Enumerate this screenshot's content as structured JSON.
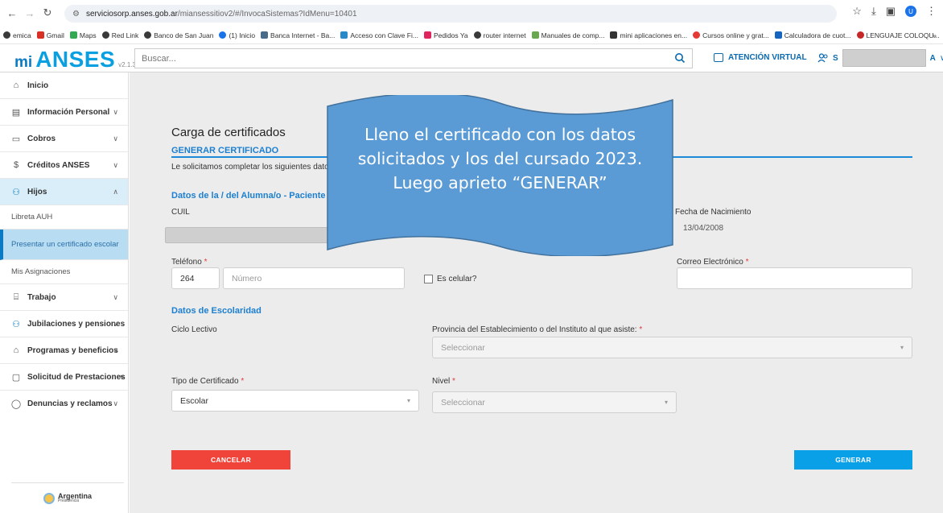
{
  "browser": {
    "url_host": "serviciosorp.anses.gob.ar",
    "url_path": "/miansessitiov2/#/InvocaSistemas?IdMenu=10401",
    "bookmarks": [
      "emica",
      "Gmail",
      "Maps",
      "Red Link",
      "Banco de San Juan",
      "(1) Inicio",
      "Banca Internet - Ba...",
      "Acceso con Clave Fi...",
      "Pedidos Ya",
      "router internet",
      "Manuales de comp...",
      "mini aplicaciones en...",
      "Cursos online y grat...",
      "Calculadora de cuot...",
      "LENGUAJE COLOQU..."
    ],
    "profile_initial": "U"
  },
  "header": {
    "logo_mi": "mi",
    "logo_anses": "ANSES",
    "version": "v2.1.3",
    "search_placeholder": "Buscar...",
    "virtual_label": "ATENCIÓN VIRTUAL",
    "user_initial": "S",
    "user_suffix": "A"
  },
  "sidebar": {
    "items": [
      {
        "label": "Inicio"
      },
      {
        "label": "Información Personal"
      },
      {
        "label": "Cobros"
      },
      {
        "label": "Créditos ANSES"
      },
      {
        "label": "Hijos"
      },
      {
        "label": "Trabajo"
      },
      {
        "label": "Jubilaciones y pensiones"
      },
      {
        "label": "Programas y beneficios"
      },
      {
        "label": "Solicitud de Prestaciones"
      },
      {
        "label": "Denuncias y reclamos"
      }
    ],
    "subitems": [
      {
        "label": "Libreta AUH"
      },
      {
        "label": "Presentar un certificado escolar"
      },
      {
        "label": "Mis Asignaciones"
      }
    ],
    "footer_brand": "Argentina",
    "footer_sub": "Presidencia"
  },
  "form": {
    "title": "Carga de certificados",
    "section_generate": "GENERAR CERTIFICADO",
    "intro": "Le solicitamos completar los siguientes dato",
    "section_student": "Datos de la / del Alumna/o - Paciente",
    "cuil_label": "CUIL",
    "birth_label": "Fecha de Nacimiento",
    "birth_value": "13/04/2008",
    "phone_label": "Teléfono",
    "phone_area": "264",
    "phone_placeholder": "Número",
    "is_mobile_label": "Es celular?",
    "email_label": "Correo Electrónico",
    "required_mark": "*",
    "section_school": "Datos de Escolaridad",
    "cycle_label": "Ciclo Lectivo",
    "province_label": "Provincia del Establecimiento o del Instituto al que asiste:",
    "province_placeholder": "Seleccionar",
    "cert_type_label": "Tipo de Certificado",
    "cert_type_value": "Escolar",
    "level_label": "Nivel",
    "level_placeholder": "Seleccionar",
    "cancel_label": "CANCELAR",
    "generate_label": "GENERAR"
  },
  "callout": {
    "text": "Lleno el certificado con los datos solicitados y los del cursado 2023. Luego aprieto “GENERAR”",
    "fill_color": "#5b9bd5"
  }
}
